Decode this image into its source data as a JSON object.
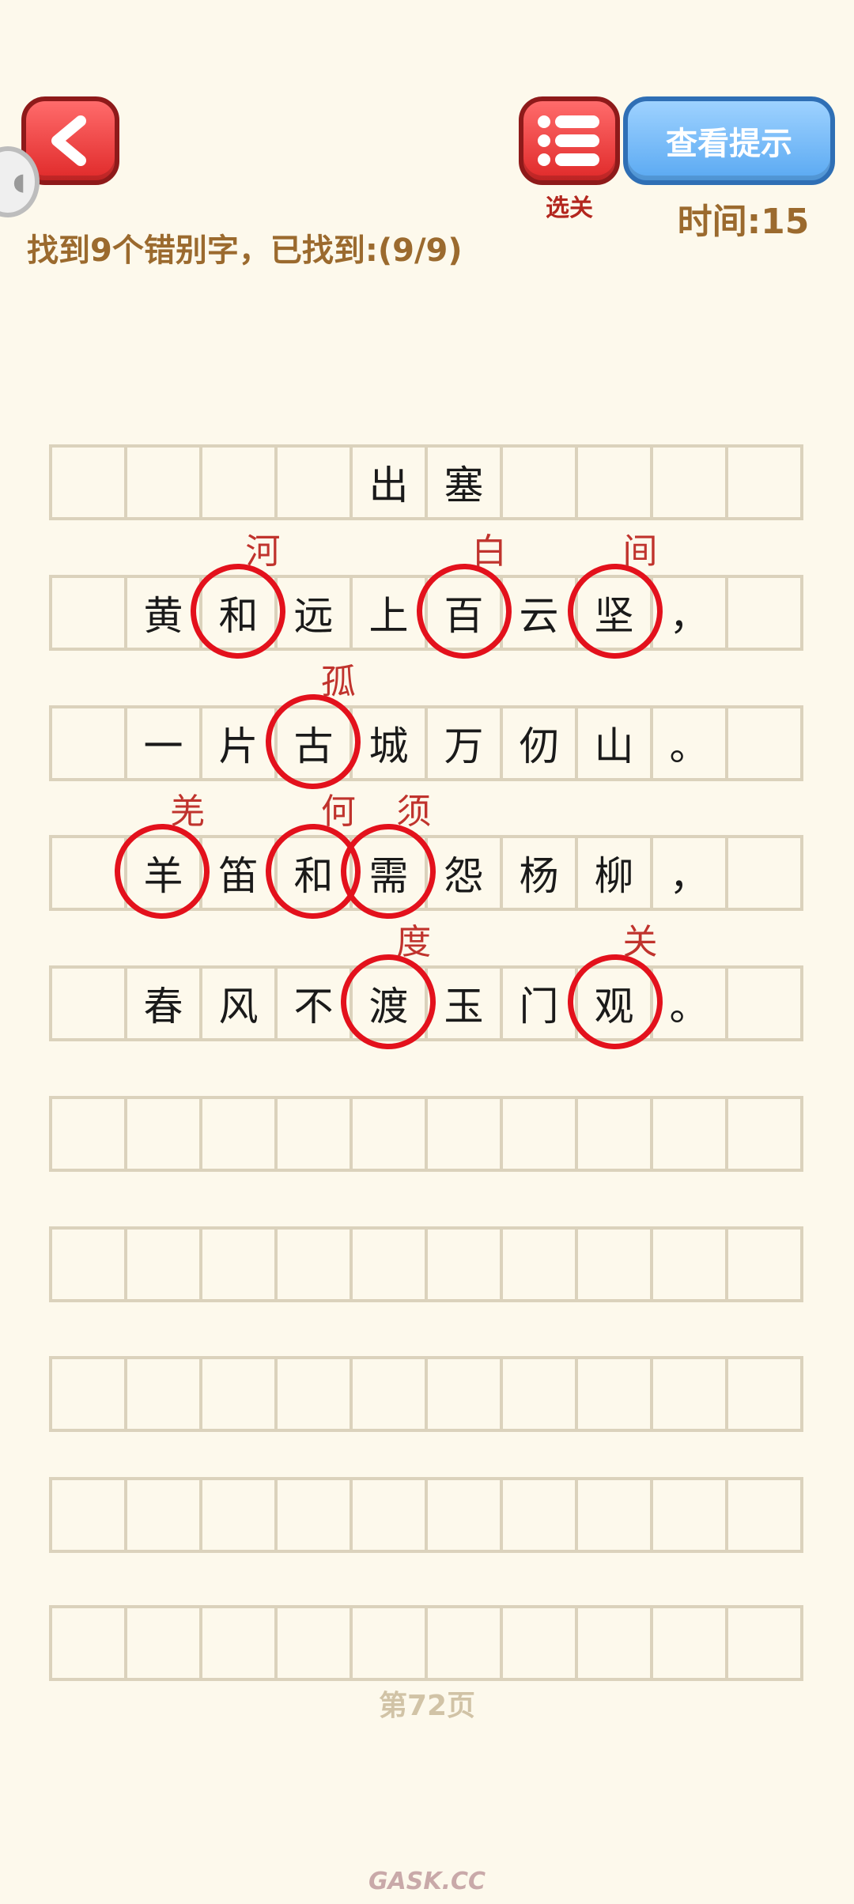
{
  "header": {
    "hint_label": "查看提示",
    "level_select_label": "选关",
    "timer_text": "时间:15",
    "progress_text": "找到9个错别字，已找到:(9/9)",
    "side_tab_glyph": "◖"
  },
  "poem": {
    "rows": [
      [
        "",
        "",
        "",
        "",
        "出",
        "塞",
        "",
        "",
        "",
        ""
      ],
      [
        "",
        "黄",
        "和",
        "远",
        "上",
        "百",
        "云",
        "坚",
        "，",
        ""
      ],
      [
        "",
        "一",
        "片",
        "古",
        "城",
        "万",
        "仞",
        "山",
        "。",
        ""
      ],
      [
        "",
        "羊",
        "笛",
        "和",
        "需",
        "怨",
        "杨",
        "柳",
        "，",
        ""
      ],
      [
        "",
        "春",
        "风",
        "不",
        "渡",
        "玉",
        "门",
        "观",
        "。",
        ""
      ],
      [
        "",
        "",
        "",
        "",
        "",
        "",
        "",
        "",
        "",
        ""
      ],
      [
        "",
        "",
        "",
        "",
        "",
        "",
        "",
        "",
        "",
        ""
      ],
      [
        "",
        "",
        "",
        "",
        "",
        "",
        "",
        "",
        "",
        ""
      ],
      [
        "",
        "",
        "",
        "",
        "",
        "",
        "",
        "",
        "",
        ""
      ],
      [
        "",
        "",
        "",
        "",
        "",
        "",
        "",
        "",
        "",
        ""
      ]
    ],
    "errors": [
      {
        "row": 1,
        "col": 2,
        "correction": "河"
      },
      {
        "row": 1,
        "col": 5,
        "correction": "白"
      },
      {
        "row": 1,
        "col": 7,
        "correction": "间"
      },
      {
        "row": 2,
        "col": 3,
        "correction": "孤"
      },
      {
        "row": 3,
        "col": 1,
        "correction": "羌"
      },
      {
        "row": 3,
        "col": 3,
        "correction": "何"
      },
      {
        "row": 3,
        "col": 4,
        "correction": "须"
      },
      {
        "row": 4,
        "col": 4,
        "correction": "度"
      },
      {
        "row": 4,
        "col": 7,
        "correction": "关"
      }
    ]
  },
  "footer": {
    "page_label": "第72页",
    "watermark": "GASK.CC"
  },
  "colors": {
    "background": "#fdf9ec",
    "grid_line": "#dbd2bc",
    "circle": "#e3111c",
    "correction": "#c0332d",
    "accent_brown": "#9b6a2e",
    "button_red": "#e02a2a",
    "button_blue": "#5aa9f2"
  }
}
